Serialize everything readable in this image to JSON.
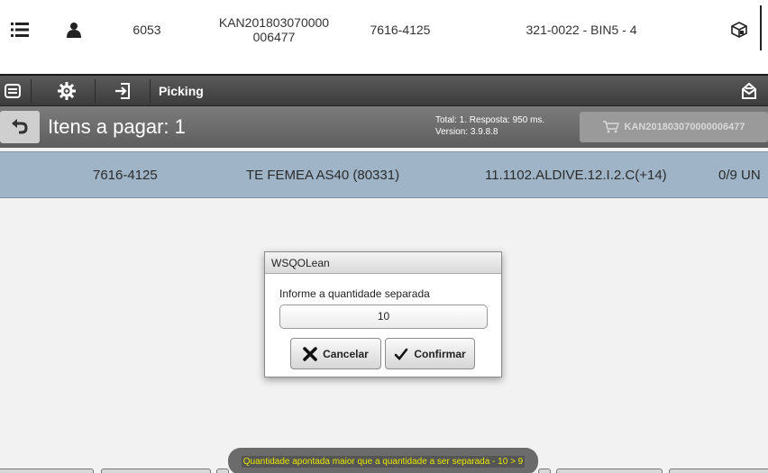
{
  "topbar": {
    "list_icon": "list-icon",
    "user_icon": "user-icon",
    "user_code": "6053",
    "kan_code": "KAN201803070000 006477",
    "part_number": "7616-4125",
    "location": "321-0022 - BIN5 - 4",
    "box_icon": "box-icon"
  },
  "toolbar": {
    "menu_icon": "menu-icon",
    "settings_icon": "gear-icon",
    "login_icon": "login-icon",
    "title": "Picking",
    "message_icon": "message-icon"
  },
  "subheader": {
    "title": "Itens a pagar: 1",
    "stats_line1": "Total: 1. Resposta: 950 ms.",
    "stats_line2": "Version: 3.9.8.8",
    "kan_button": "KAN201803070000006477"
  },
  "item": {
    "part": "7616-4125",
    "description": "TE FEMEA AS40 (80331)",
    "location": "11.1102.ALDIVE.12.I.2.C(+14)",
    "quantity": "0/9 UN"
  },
  "dialog": {
    "title": "WSQOLean",
    "label": "Informe a quantidade separada",
    "value": "10",
    "cancel": "Cancelar",
    "confirm": "Confirmar"
  },
  "toast": "Quantidade apontada maior que a quantidade a ser separada - 10 > 9",
  "colors": {
    "item_row": "#9fb5c7",
    "toolbar": "#4a4a4a",
    "toast_text": "#e8e800"
  }
}
